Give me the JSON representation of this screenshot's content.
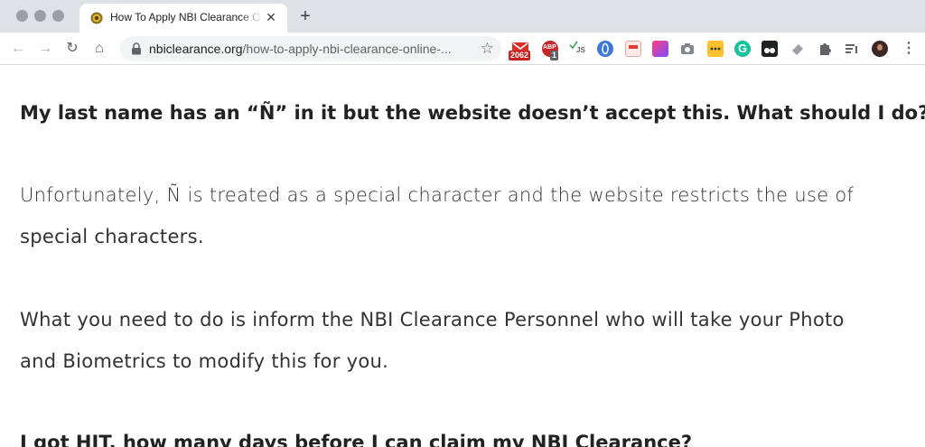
{
  "browser": {
    "tab": {
      "title": "How To Apply NBI Clearance Online",
      "close_glyph": "✕"
    },
    "new_tab_glyph": "+",
    "nav": {
      "back_glyph": "←",
      "forward_glyph": "→",
      "reload_glyph": "↻",
      "home_glyph": "⌂"
    },
    "url": {
      "host": "nbiclearance.org",
      "path": "/how-to-apply-nbi-clearance-online-..."
    },
    "star_glyph": "☆",
    "extensions": {
      "gmail_badge": "2062",
      "abp_badge": "1",
      "abp_label": "ABP",
      "js_label": "JS",
      "grammarly_label": "G"
    },
    "colors": {
      "tabstrip": "#dee1e6",
      "omnibox": "#f1f3f4"
    }
  },
  "article": {
    "question1": "My last name has an “Ñ” in it but the website doesn’t accept this. What should I do?",
    "answer1_line1": "Unfortunately, Ñ is treated as a special character and the website restricts the use of",
    "answer1_line2": "special characters.",
    "answer2_line1": "What you need to do is inform the NBI Clearance Personnel who will take your Photo",
    "answer2_line2": "and Biometrics to modify this for you.",
    "question2": "I got HIT, how many days before I can claim my NBI Clearance?"
  }
}
